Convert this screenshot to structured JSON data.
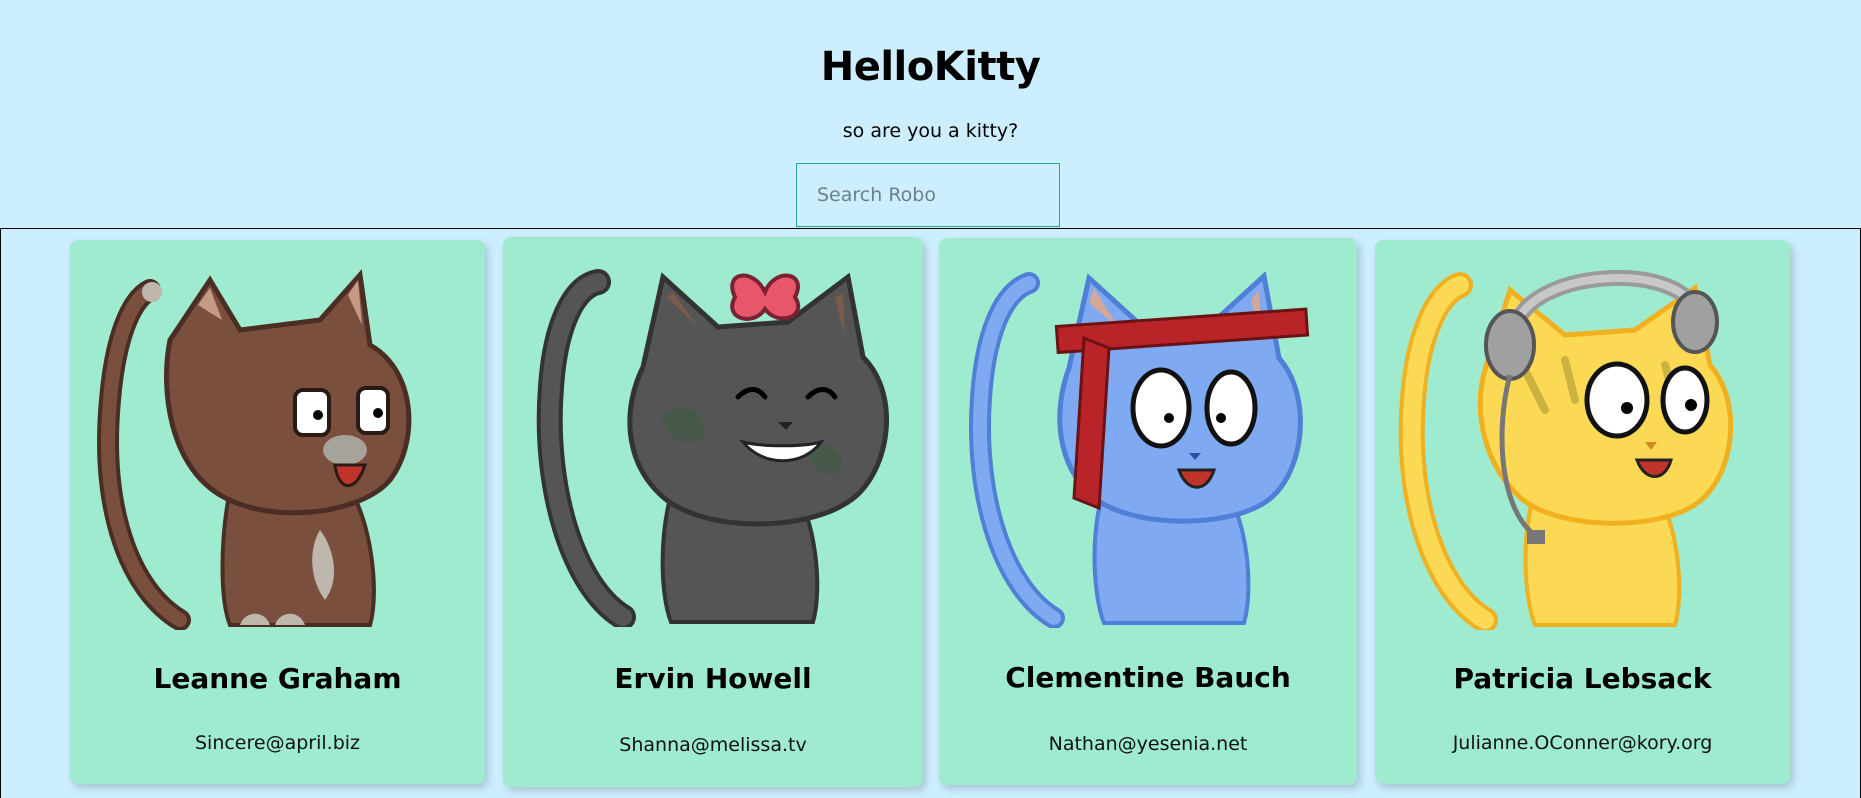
{
  "header": {
    "title": "HelloKitty",
    "subtitle": "so are you a kitty?",
    "search_placeholder": "Search Robo"
  },
  "cards": [
    {
      "name": "Leanne Graham",
      "email": "Sincere@april.biz",
      "kitty_color": "#7b4f3e"
    },
    {
      "name": "Ervin Howell",
      "email": "Shanna@melissa.tv",
      "kitty_color": "#555555"
    },
    {
      "name": "Clementine Bauch",
      "email": "Nathan@yesenia.net",
      "kitty_color": "#7fa9f0"
    },
    {
      "name": "Patricia Lebsack",
      "email": "Julianne.OConner@kory.org",
      "kitty_color": "#fbd954"
    }
  ],
  "colors": {
    "background": "#cdeeff",
    "card": "#9eebcf",
    "search_border": "#28a88a"
  }
}
